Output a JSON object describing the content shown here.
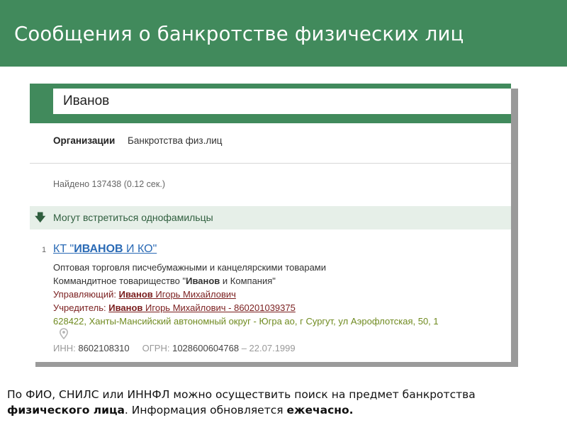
{
  "slide": {
    "title": "Сообщения о банкротстве физических лиц",
    "header_color": "#418a5c"
  },
  "search": {
    "value": "Иванов"
  },
  "tabs": [
    {
      "label": "Организации",
      "active": true
    },
    {
      "label": "Банкротства физ.лиц",
      "active": false
    }
  ],
  "results_info": "Найдено 137438 (0.12 сек.)",
  "namesakes": {
    "icon": "arrow-down-icon",
    "label": "Могут встретиться однофамильцы"
  },
  "result": {
    "number": "1",
    "title_prefix": "КТ \"",
    "title_bold": "ИВАНОВ",
    "title_suffix": " И КО\"",
    "activity": "Оптовая торговля писчебумажными и канцелярскими товарами",
    "legal_form_prefix": "Коммандитное товарищество \"",
    "legal_form_bold": "Иванов",
    "legal_form_suffix": " и Компания\"",
    "manager_label": "Управляющий: ",
    "manager_bold": "Иванов",
    "manager_rest": " Игорь Михайлович",
    "founder_label": "Учредитель: ",
    "founder_bold": "Иванов",
    "founder_rest": " Игорь Михайлович - 860201039375",
    "address": "628422, Ханты-Мансийский автономный округ - Югра ао, г Сургут, ул Аэрофлотская, 50, 1",
    "address_icon": "location-pin-icon",
    "inn_label": "ИНН: ",
    "inn_value": "8602108310",
    "ogrn_label": "ОГРН: ",
    "ogrn_value": "1028600604768",
    "date": " – 22.07.1999"
  },
  "footer": {
    "part1": "По ФИО, СНИЛС или ИННФЛ можно осуществить поиск на предмет банкротства ",
    "part2_bold": "физического лица",
    "part3": ". Информация обновляется ",
    "part4_bold": "ежечасно."
  }
}
